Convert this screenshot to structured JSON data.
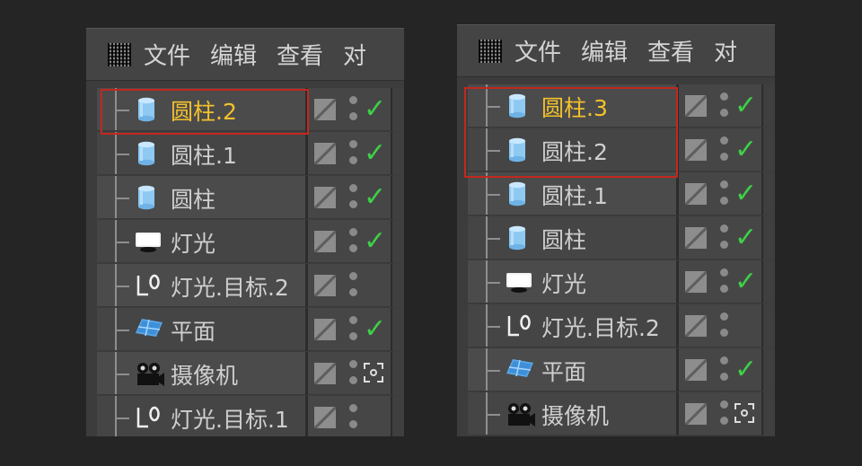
{
  "menu": [
    "文件",
    "编辑",
    "查看",
    "对"
  ],
  "colors": {
    "active_label": "#f3c12b",
    "highlight_border": "#c2281e",
    "check": "#3ed048"
  },
  "left_panel": {
    "rows": [
      {
        "label": "圆柱.2",
        "icon": "cylinder-icon",
        "active": true,
        "status": "check"
      },
      {
        "label": "圆柱.1",
        "icon": "cylinder-icon",
        "active": false,
        "status": "check"
      },
      {
        "label": "圆柱",
        "icon": "cylinder-icon",
        "active": false,
        "status": "check"
      },
      {
        "label": "灯光",
        "icon": "light-icon",
        "active": false,
        "status": "check"
      },
      {
        "label": "灯光.目标.2",
        "icon": "target-icon",
        "active": false,
        "status": "none"
      },
      {
        "label": "平面",
        "icon": "plane-icon",
        "active": false,
        "status": "check"
      },
      {
        "label": "摄像机",
        "icon": "camera-icon",
        "active": false,
        "status": "camera-tag"
      },
      {
        "label": "灯光.目标.1",
        "icon": "target-icon",
        "active": false,
        "status": "none"
      }
    ]
  },
  "right_panel": {
    "rows": [
      {
        "label": "圆柱.3",
        "icon": "cylinder-icon",
        "active": true,
        "status": "check"
      },
      {
        "label": "圆柱.2",
        "icon": "cylinder-icon",
        "active": false,
        "status": "check"
      },
      {
        "label": "圆柱.1",
        "icon": "cylinder-icon",
        "active": false,
        "status": "check"
      },
      {
        "label": "圆柱",
        "icon": "cylinder-icon",
        "active": false,
        "status": "check"
      },
      {
        "label": "灯光",
        "icon": "light-icon",
        "active": false,
        "status": "check"
      },
      {
        "label": "灯光.目标.2",
        "icon": "target-icon",
        "active": false,
        "status": "none"
      },
      {
        "label": "平面",
        "icon": "plane-icon",
        "active": false,
        "status": "check"
      },
      {
        "label": "摄像机",
        "icon": "camera-icon",
        "active": false,
        "status": "camera-tag"
      }
    ]
  }
}
